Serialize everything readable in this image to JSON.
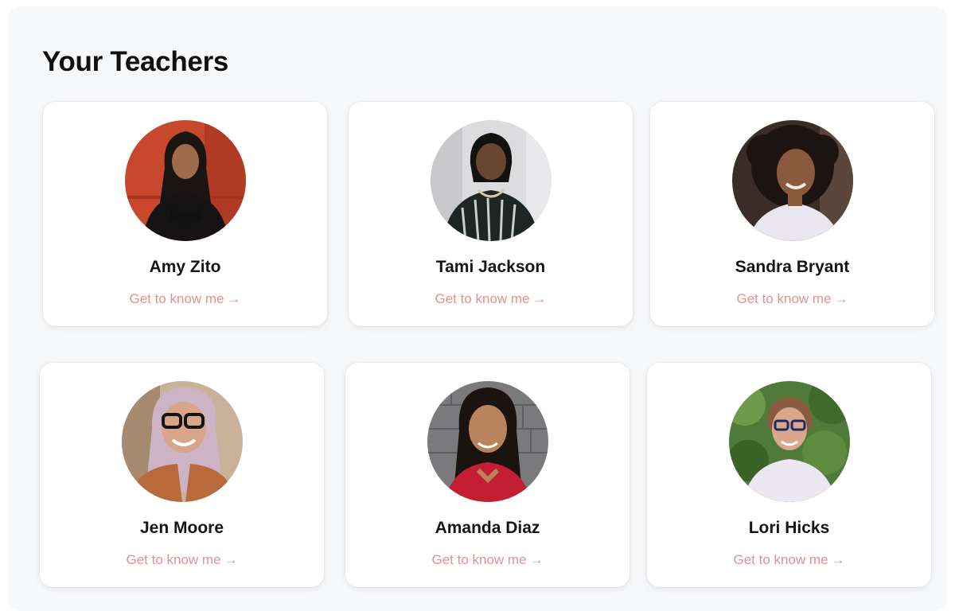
{
  "section": {
    "title": "Your Teachers"
  },
  "teachers": [
    {
      "name": "Amy Zito",
      "link_label": "Get to know me",
      "arrow": "→"
    },
    {
      "name": "Tami Jackson",
      "link_label": "Get to know me",
      "arrow": "→"
    },
    {
      "name": "Sandra Bryant",
      "link_label": "Get to know me",
      "arrow": "→"
    },
    {
      "name": "Jen Moore",
      "link_label": "Get to know me",
      "arrow": "→"
    },
    {
      "name": "Amanda Diaz",
      "link_label": "Get to know me",
      "arrow": "→"
    },
    {
      "name": "Lori Hicks",
      "link_label": "Get to know me",
      "arrow": "→"
    }
  ],
  "colors": {
    "link": "#e58f8f",
    "panel_bg": "#f7f8fa",
    "card_bg": "#ffffff"
  }
}
